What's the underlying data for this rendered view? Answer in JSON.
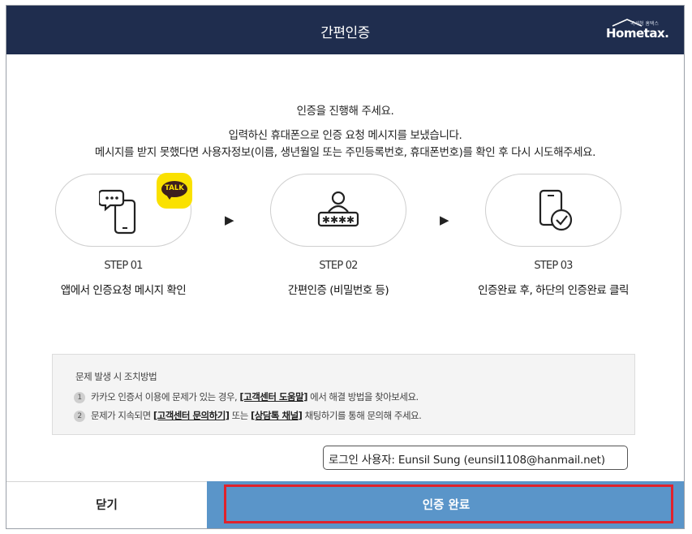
{
  "header": {
    "title": "간편인증",
    "logo_text": "Hometax.",
    "logo_small": "국세청 홈택스"
  },
  "instructions": {
    "line1": "인증을 진행해 주세요.",
    "line2": "입력하신 휴대폰으로 인증 요청 메시지를 보냈습니다.",
    "line3": "메시지를 받지 못했다면 사용자정보(이름, 생년월일 또는 주민등록번호, 휴대폰번호)를 확인 후 다시 시도해주세요."
  },
  "kakao_badge": "TALK",
  "steps": [
    {
      "label": "STEP 01",
      "desc": "앱에서 인증요청 메시지 확인",
      "icon": "phone-message-icon"
    },
    {
      "label": "STEP 02",
      "desc": "간편인증 (비밀번호 등)",
      "icon": "user-password-icon"
    },
    {
      "label": "STEP 03",
      "desc": "인증완료 후, 하단의 인증완료 클릭",
      "icon": "phone-check-icon"
    }
  ],
  "arrow_glyph": "▶",
  "help": {
    "title": "문제 발생 시 조치방법",
    "item1": {
      "num": "1",
      "pre": "카카오 인증서 이용에 문제가 있는 경우, ",
      "link": "[고객센터 도움말]",
      "post": " 에서 해결 방법을 찾아보세요."
    },
    "item2": {
      "num": "2",
      "pre": "문제가 지속되면 ",
      "link1": "[고객센터 문의하기]",
      "mid": " 또는 ",
      "link2": "[상담톡 채널]",
      "post": " 채팅하기를 통해 문의해 주세요."
    }
  },
  "tooltip": "로그인 사용자: Eunsil Sung (eunsil1108@hanmail.net)",
  "footer": {
    "close_label": "닫기",
    "complete_label": "인증 완료"
  },
  "colors": {
    "header_bg": "#1f2d4e",
    "primary_button": "#5a95c9",
    "highlight_outline": "#e0222c",
    "kakao_yellow": "#fae100"
  }
}
